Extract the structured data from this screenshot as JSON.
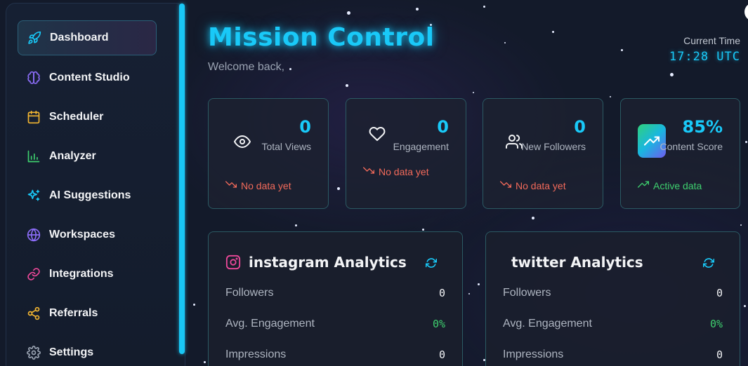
{
  "sidebar": {
    "items": [
      {
        "label": "Dashboard",
        "icon": "rocket-icon",
        "color": "#19c9f8",
        "active": true
      },
      {
        "label": "Content Studio",
        "icon": "brain-icon",
        "color": "#8b6cf6"
      },
      {
        "label": "Scheduler",
        "icon": "calendar-icon",
        "color": "#f5b731"
      },
      {
        "label": "Analyzer",
        "icon": "bar-chart-icon",
        "color": "#3ecf6e"
      },
      {
        "label": "AI Suggestions",
        "icon": "sparkles-icon",
        "color": "#19c9f8"
      },
      {
        "label": "Workspaces",
        "icon": "globe-icon",
        "color": "#8b6cf6"
      },
      {
        "label": "Integrations",
        "icon": "link-icon",
        "color": "#ec4899"
      },
      {
        "label": "Referrals",
        "icon": "share-icon",
        "color": "#f5b731"
      },
      {
        "label": "Settings",
        "icon": "gear-icon",
        "color": "#9aa3b2"
      }
    ]
  },
  "header": {
    "title": "Mission Control",
    "welcome": "Welcome back,",
    "time_label": "Current Time",
    "time_value": "17:28 UTC"
  },
  "stats": [
    {
      "value": "0",
      "label": "Total Views",
      "trend": "No data yet",
      "icon": "eye-icon"
    },
    {
      "value": "0",
      "label": "Engagement",
      "trend": "No data yet",
      "icon": "heart-icon"
    },
    {
      "value": "0",
      "label": "New Followers",
      "trend": "No data yet",
      "icon": "users-icon"
    },
    {
      "value": "85%",
      "label": "Content Score",
      "trend": "Active data",
      "icon": "trending-up-icon"
    }
  ],
  "panels": [
    {
      "title": "instagram Analytics",
      "icon": "instagram-icon",
      "metrics": [
        {
          "label": "Followers",
          "value": "0"
        },
        {
          "label": "Avg. Engagement",
          "value": "0%"
        },
        {
          "label": "Impressions",
          "value": "0"
        }
      ]
    },
    {
      "title": "twitter Analytics",
      "icon": "",
      "metrics": [
        {
          "label": "Followers",
          "value": "0"
        },
        {
          "label": "Avg. Engagement",
          "value": "0%"
        },
        {
          "label": "Impressions",
          "value": "0"
        }
      ]
    }
  ],
  "colors": {
    "accent": "#19c9f8",
    "negative": "#f26a5a",
    "positive": "#3ecf6e",
    "background": "#131a2a"
  }
}
